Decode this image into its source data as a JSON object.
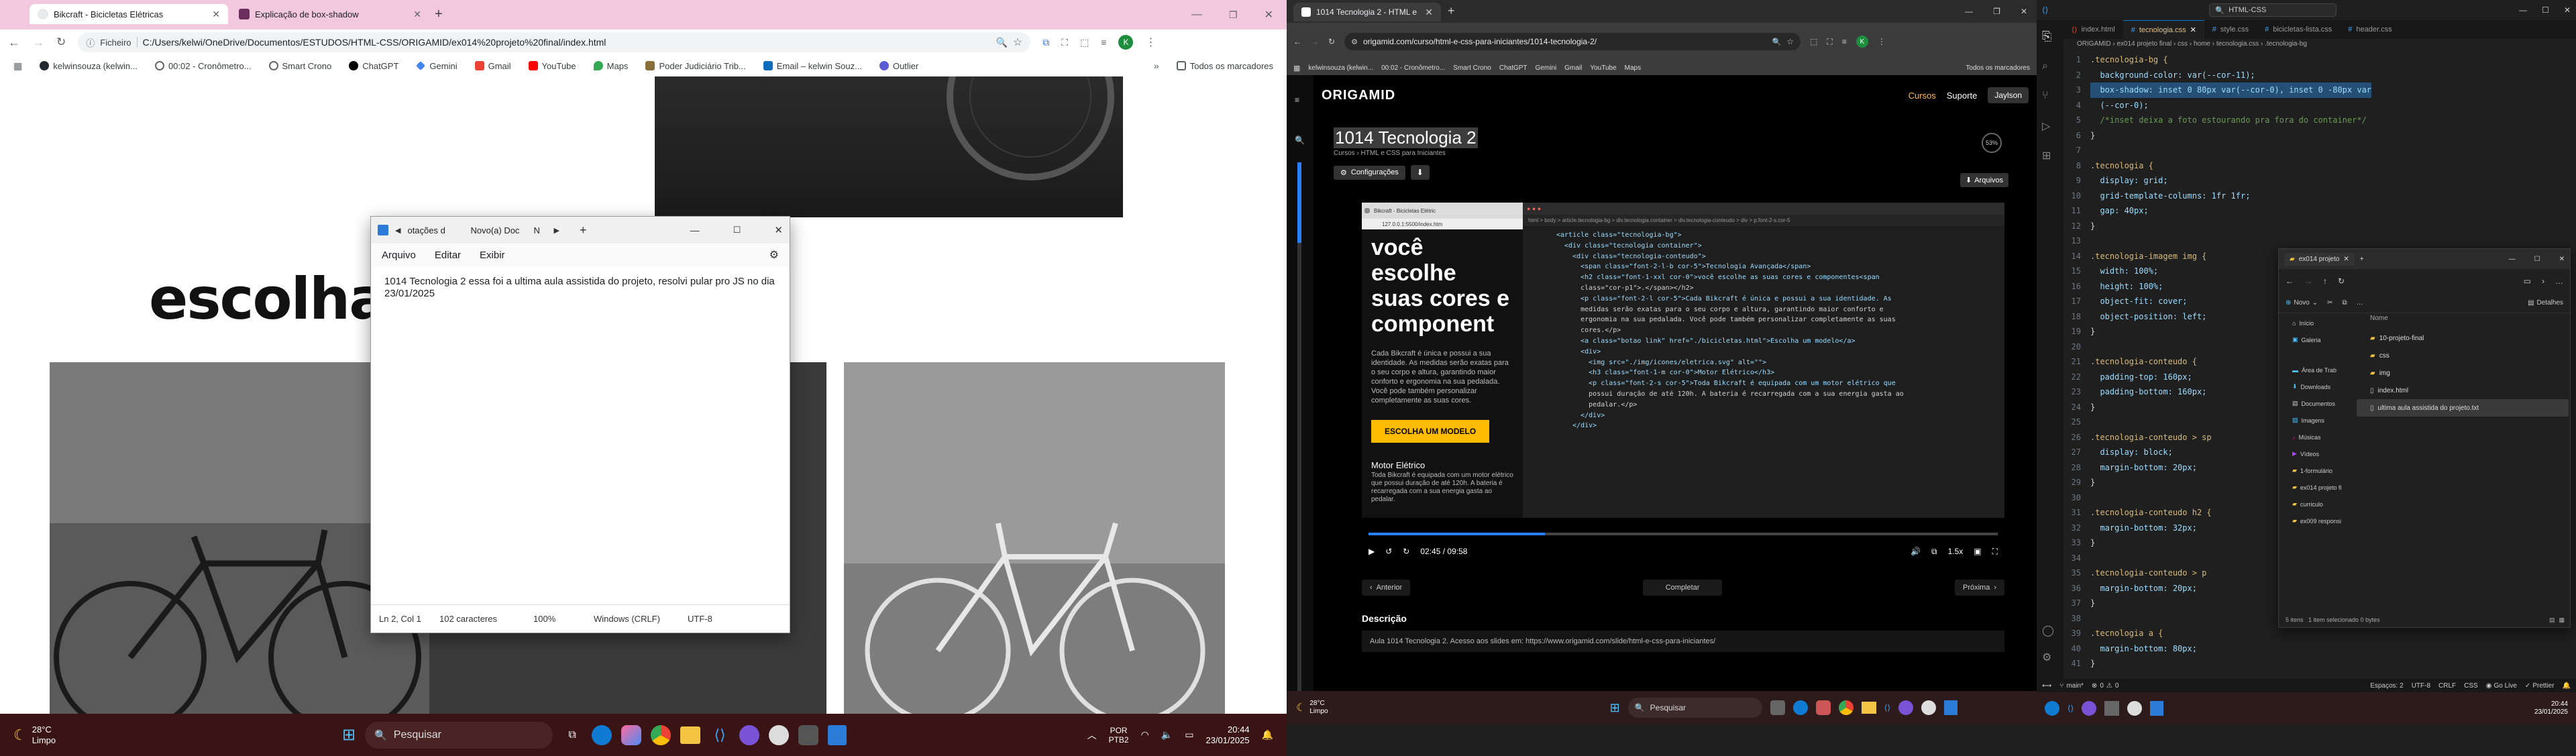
{
  "left_browser": {
    "tabs": [
      {
        "label": "Bikcraft - Bicicletas Elétricas",
        "active": true
      },
      {
        "label": "Explicação de box-shadow",
        "active": false
      }
    ],
    "address_prefix": "Ficheiro",
    "address": "C:/Users/kelwi/OneDrive/Documentos/ESTUDOS/HTML-CSS/ORIGAMID/ex014%20projeto%20final/index.html",
    "bookmarks": [
      "kelwinsouza (kelwin...",
      "00:02 - Cronômetro...",
      "Smart Crono",
      "ChatGPT",
      "Gemini",
      "Gmail",
      "YouTube",
      "Maps",
      "Poder Judiciário Trib...",
      "Email – kelwin Souz...",
      "Outlier"
    ],
    "all_bookmarks": "Todos os marcadores",
    "heading": "escolha"
  },
  "notepad": {
    "tab_label": "otações d",
    "tab2_label": "Novo(a) Doc",
    "tab3_label": "N",
    "menu": [
      "Arquivo",
      "Editar",
      "Exibir"
    ],
    "text": "1014 Tecnologia 2 essa foi a ultima aula assistida do projeto, resolvi pular pro JS no dia 23/01/2025",
    "status": {
      "pos": "Ln 2, Col 1",
      "chars": "102 caracteres",
      "zoom": "100%",
      "eol": "Windows (CRLF)",
      "enc": "UTF-8"
    }
  },
  "left_taskbar": {
    "weather_temp": "28°C",
    "weather_desc": "Limpo",
    "search": "Pesquisar",
    "lang1": "POR",
    "lang2": "PTB2",
    "time": "20:44",
    "date": "23/01/2025"
  },
  "mid_browser": {
    "tab": "1014 Tecnologia 2 - HTML e CSS",
    "address": "origamid.com/curso/html-e-css-para-iniciantes/1014-tecnologia-2/",
    "bookmarks": [
      "kelwinsouza (kelwin...",
      "00:02 - Cronômetro...",
      "Smart Crono",
      "ChatGPT",
      "Gemini",
      "Gmail",
      "YouTube",
      "Maps"
    ],
    "all_bookmarks": "Todos os marcadores",
    "nav": [
      "Cursos",
      "Suporte"
    ],
    "user": "Jaylson",
    "logo": "ORIGAMID",
    "lesson_title": "1014 Tecnologia 2",
    "breadcrumb": "Cursos › HTML e CSS para Iniciantes",
    "progress_badge": "53%",
    "config_btn": "Configurações",
    "files_btn": "Arquivos",
    "video_time": "02:45 / 09:58",
    "speed": "1.5x",
    "prev": "Anterior",
    "complete": "Completar",
    "next": "Próxima",
    "desc_title": "Descrição",
    "desc_text": "Aula 1014 Tecnologia 2. Acesso aos slides em: https://www.origamid.com/slide/html-e-css-para-iniciantes/",
    "video_hero": "você escolhe suas cores e component",
    "video_cta": "ESCOLHA UM MODELO",
    "video_motor": "Motor Elétrico",
    "video_para": "Cada Bikcraft é única e possui a sua identidade. As medidas serão exatas para o seu corpo e altura, garantindo maior conforto e ergonomia na sua pedalada. Você pode também personalizar completamente as suas cores.",
    "video_motor_para": "Toda Bikcraft é equipada com um motor elétrico que possui duração de até 120h. A bateria é recarregada com a sua energia gasta ao pedalar.",
    "video_url": "127.0.0.1:5500/index.htm",
    "video_tab": "Bikcraft - Bicicletas Elétric",
    "video_crumb": "html > body > article.tecnologia-bg > div.tecnologia.container > div.tecnologia-conteudo > div > p.font-2-s.cor-5",
    "code_lines": [
      "<article class=\"tecnologia-bg\">",
      "  <div class=\"tecnologia container\">",
      "    <div class=\"tecnologia-conteudo\">",
      "      <span class=\"font-2-l-b cor-5\">Tecnologia Avançada</span>",
      "      <h2 class=\"font-1-xxl cor-0\">você escolhe as suas cores e componentes<span",
      "      class=\"cor-p1\">.</span></h2>",
      "      <p class=\"font-2-l cor-5\">Cada Bikcraft é única e possui a sua identidade. As",
      "      medidas serão exatas para o seu corpo e altura, garantindo maior conforto e",
      "      ergonomia na sua pedalada. Você pode também personalizar completamente as suas",
      "      cores.</p>",
      "      <a class=\"botao link\" href=\"./bicicletas.html\">Escolha um modelo</a>",
      "      <div>",
      "        <img src=\"./img/icones/eletrica.svg\" alt=\"\">",
      "        <h3 class=\"font-1-m cor-0\">Motor Elétrico</h3>",
      "        <p class=\"font-2-s cor-5\">Toda Bikcraft é equipada com um motor elétrico que",
      "        possui duração de até 120h. A bateria é recarregada com a sua energia gasta ao",
      "        pedalar.</p>",
      "      </div>",
      "    </div>"
    ]
  },
  "mid_taskbar": {
    "weather_temp": "28°C",
    "weather_desc": "Limpo",
    "search": "Pesquisar"
  },
  "vscode": {
    "title": "HTML-CSS",
    "tabs": [
      "index.html",
      "tecnologia.css",
      "style.css",
      "bicicletas-lista.css",
      "header.css"
    ],
    "active_tab": "tecnologia.css",
    "breadcrumb": "ORIGAMID › ex014 projeto final › css › home › tecnologia.css › .tecnologia-bg",
    "status": {
      "branch": "main*",
      "errors": "0",
      "warnings": "0",
      "spaces": "Espaços: 2",
      "enc": "UTF-8",
      "eol": "CRLF",
      "lang": "CSS",
      "golive": "Go Live",
      "prettier": "Prettier"
    },
    "code": [
      ".tecnologia-bg {",
      "  background-color: var(--cor-11);",
      "  box-shadow: inset 0 80px var(--cor-0), inset 0 -80px var",
      "  (--cor-0);",
      "  /*inset deixa a foto estourando pra fora do container*/",
      "}",
      "",
      ".tecnologia {",
      "  display: grid;",
      "  grid-template-columns: 1fr 1fr;",
      "  gap: 40px;",
      "}",
      "",
      ".tecnologia-imagem img {",
      "  width: 100%;",
      "  height: 100%;",
      "  object-fit: cover;",
      "  object-position: left;",
      "}",
      "",
      ".tecnologia-conteudo {",
      "  padding-top: 160px;",
      "  padding-bottom: 160px;",
      "}",
      "",
      ".tecnologia-conteudo > sp",
      "  display: block;",
      "  margin-bottom: 20px;",
      "}",
      "",
      ".tecnologia-conteudo h2 {",
      "  margin-bottom: 32px;",
      "}",
      "",
      ".tecnologia-conteudo > p",
      "  margin-bottom: 20px;",
      "}",
      "",
      ".tecnologia a {",
      "  margin-bottom: 80px;",
      "}"
    ],
    "line_start": 1
  },
  "explorer": {
    "tab": "ex014 projeto",
    "new_btn": "Novo",
    "details_btn": "Detalhes",
    "header": "Nome",
    "sidebar": [
      "Início",
      "Galeria",
      "Área de Trab",
      "Downloads",
      "Documentos",
      "Imagens",
      "Músicas",
      "Vídeos",
      "1-formulário",
      "ex014 projeto fi",
      "curriculo",
      "ex009 responsi"
    ],
    "files": [
      "10-projeto-final",
      "css",
      "img",
      "index.html",
      "ultima aula assistida do projeto.txt"
    ],
    "status": "5 itens   1 item selecionado 0 bytes"
  },
  "right_taskbar": {
    "time": "20:44",
    "date": "23/01/2025"
  }
}
